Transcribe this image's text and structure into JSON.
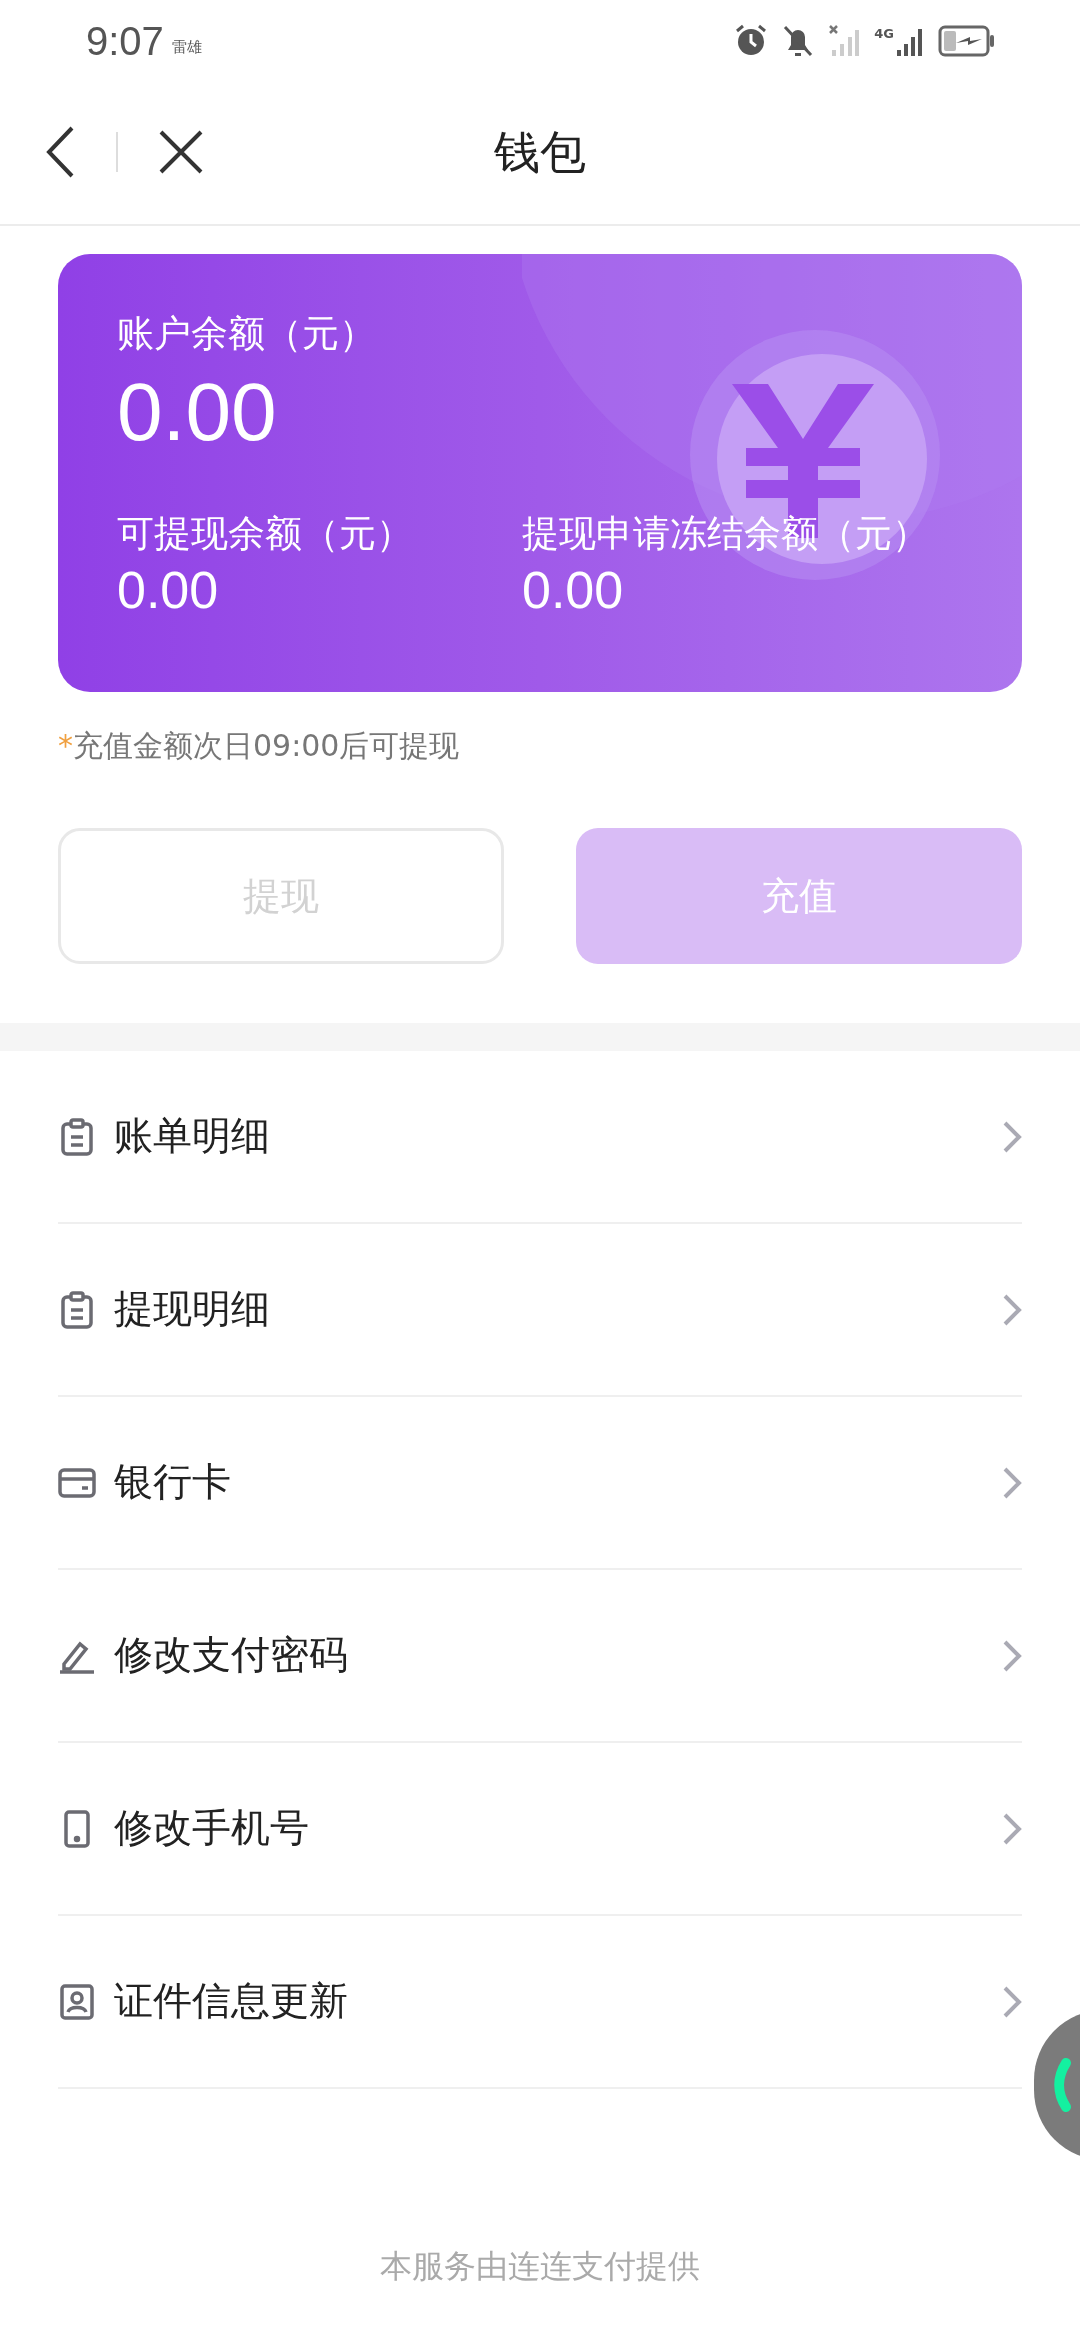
{
  "status_bar": {
    "time": "9:07",
    "carrier": "雷雄",
    "network": "4G"
  },
  "header": {
    "title": "钱包"
  },
  "balance_card": {
    "total_label": "账户余额（元）",
    "total_value": "0.00",
    "stats": [
      {
        "label": "可提现余额（元）",
        "value": "0.00"
      },
      {
        "label": "提现申请冻结余额（元）",
        "value": "0.00"
      }
    ]
  },
  "note": {
    "mark": "*",
    "text": "充值金额次日09:00后可提现"
  },
  "actions": [
    {
      "label": "提现",
      "kind": "outline",
      "disabled": true
    },
    {
      "label": "充值",
      "kind": "filled",
      "disabled": true
    }
  ],
  "menu": [
    {
      "label": "账单明细"
    },
    {
      "label": "提现明细"
    },
    {
      "label": "银行卡"
    },
    {
      "label": "修改支付密码"
    },
    {
      "label": "修改手机号"
    },
    {
      "label": "证件信息更新"
    }
  ],
  "footer": "本服务由连连支付提供"
}
